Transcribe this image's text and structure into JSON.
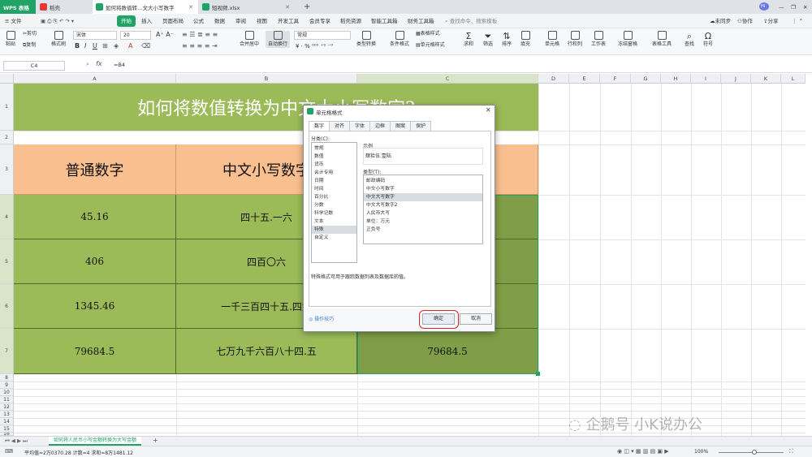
{
  "tabs": [
    {
      "label": "WPS 表格",
      "active": false
    },
    {
      "label": "稻壳",
      "active": false
    },
    {
      "label": "如何将数值转…文大小写数字",
      "active": true
    },
    {
      "label": "短视频.xlsx",
      "active": false
    }
  ],
  "window": {
    "minimize": "—",
    "restore": "❐",
    "close": "✕",
    "plus": "+"
  },
  "menu": {
    "file": "≡ 文件",
    "items": [
      "开始",
      "插入",
      "页面布局",
      "公式",
      "数据",
      "审阅",
      "视图",
      "开发工具",
      "会员专享",
      "稻壳资源",
      "智能工具箱",
      "财务工具箱"
    ],
    "search": "查找命令、搜索模板",
    "sync": "未同步",
    "collab": "协作",
    "share": "分享"
  },
  "toolbar": {
    "paste": "粘贴",
    "cut": "剪切",
    "copy": "复制",
    "format_painter": "格式刷",
    "font_name": "宋体",
    "font_size": "20",
    "wrap": "自动换行",
    "merge": "合并居中",
    "number_format": "常规",
    "type_convert": "类型转换",
    "cond_format": "条件格式",
    "table_style": "表格样式",
    "cell_style": "单元格样式",
    "sum": "求和",
    "filter": "筛选",
    "sort": "排序",
    "fill": "填充",
    "cells": "单元格",
    "rowcol": "行和列",
    "worksheet": "工作表",
    "freeze": "冻结窗格",
    "table_tools": "表格工具",
    "find": "查找",
    "symbol": "符号"
  },
  "formula_bar": {
    "cell_ref": "C4",
    "fx": "fx",
    "formula": "=B4"
  },
  "columns": [
    "A",
    "B",
    "C",
    "D",
    "E",
    "F",
    "G",
    "H",
    "I",
    "J",
    "K",
    "L"
  ],
  "rows": [
    "1",
    "2",
    "3",
    "4",
    "5",
    "6",
    "7",
    "8",
    "9",
    "10",
    "11",
    "12",
    "13",
    "14",
    "15",
    "16"
  ],
  "sheet": {
    "title": "如何将数值转换为中文大小写数字?",
    "headers": [
      "普通数字",
      "中文小写数字",
      "中文大写数字"
    ],
    "data": [
      [
        "45.16",
        "四十五.一六",
        ""
      ],
      [
        "406",
        "四百〇六",
        ""
      ],
      [
        "1345.46",
        "一千三百四十五.四六",
        ""
      ],
      [
        "79684.5",
        "七万九千六百八十四.五",
        "79684.5"
      ]
    ]
  },
  "dialog": {
    "title": "单元格格式",
    "close": "✕",
    "tabs": [
      "数字",
      "对齐",
      "字体",
      "边框",
      "图案",
      "保护"
    ],
    "category_label": "分类(C):",
    "categories": [
      "常规",
      "数值",
      "货币",
      "会计专用",
      "日期",
      "时间",
      "百分比",
      "分数",
      "科学记数",
      "文本",
      "特殊",
      "自定义"
    ],
    "selected_category": "特殊",
    "sample_label": "示例",
    "sample_value": "肆拾伍.壹陆",
    "type_label": "类型(T):",
    "types": [
      "邮政编码",
      "中文小写数字",
      "中文大写数字",
      "中文大写数字2",
      "人民币大写",
      "单位：万元",
      "正负号"
    ],
    "selected_type": "中文大写数字",
    "description": "特殊格式可用于跟踪数据列表及数据库的值。",
    "tips": "操作技巧",
    "ok": "确定",
    "cancel": "取消"
  },
  "sheet_tab": "如何将人民币小写金额转换为大写金额",
  "status": {
    "summary": "平均值=2万0370.28  计数=4  求和=8万1481.12",
    "zoom": "100%"
  },
  "watermark": "企鹅号 小K说办公",
  "colors": {
    "title_bg": "#9bbb59",
    "header_bg": "#f9bf8f",
    "data_bg": "#9bbb59",
    "selected_bg": "#7f9e47",
    "wps_green": "#21a366",
    "ok_ring": "#d9262c"
  }
}
